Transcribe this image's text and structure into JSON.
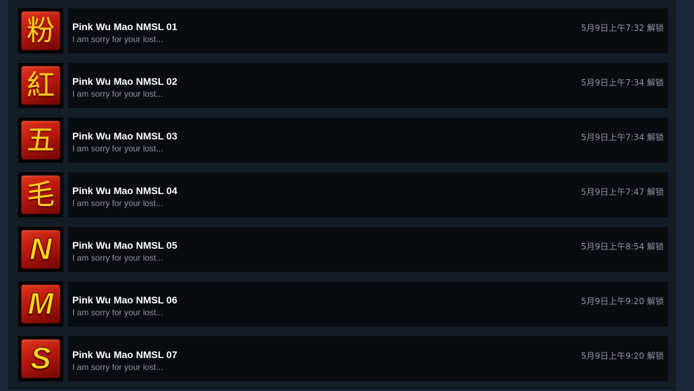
{
  "achievements": [
    {
      "icon_glyph": "粉",
      "icon_name": "fen-character-icon",
      "icon_style": "cjk",
      "title": "Pink Wu Mao NMSL 01",
      "description": "I am sorry for your lost...",
      "unlock_time": "5月9日上午7:32 解锁"
    },
    {
      "icon_glyph": "紅",
      "icon_name": "hong-character-icon",
      "icon_style": "cjk",
      "title": "Pink Wu Mao NMSL 02",
      "description": "I am sorry for your lost...",
      "unlock_time": "5月9日上午7:34 解锁"
    },
    {
      "icon_glyph": "五",
      "icon_name": "wu-character-icon",
      "icon_style": "cjk",
      "title": "Pink Wu Mao NMSL 03",
      "description": "I am sorry for your lost...",
      "unlock_time": "5月9日上午7:34 解锁"
    },
    {
      "icon_glyph": "毛",
      "icon_name": "mao-character-icon",
      "icon_style": "cjk",
      "title": "Pink Wu Mao NMSL 04",
      "description": "I am sorry for your lost...",
      "unlock_time": "5月9日上午7:47 解锁"
    },
    {
      "icon_glyph": "N",
      "icon_name": "letter-n-icon",
      "icon_style": "latin",
      "title": "Pink Wu Mao NMSL 05",
      "description": "I am sorry for your lost...",
      "unlock_time": "5月9日上午8:54 解锁"
    },
    {
      "icon_glyph": "M",
      "icon_name": "letter-m-icon",
      "icon_style": "latin",
      "title": "Pink Wu Mao NMSL 06",
      "description": "I am sorry for your lost...",
      "unlock_time": "5月9日上午9:20 解锁"
    },
    {
      "icon_glyph": "S",
      "icon_name": "letter-s-icon",
      "icon_style": "latin",
      "title": "Pink Wu Mao NMSL 07",
      "description": "I am sorry for your lost...",
      "unlock_time": "5月9日上午9:20 解锁"
    }
  ],
  "colors": {
    "page_background": "#1b2838",
    "row_background": "#080b10",
    "title_text": "#ffffff",
    "secondary_text": "#8f98a0",
    "icon_red": "#b8170c",
    "icon_glyph": "#ffd21a"
  }
}
